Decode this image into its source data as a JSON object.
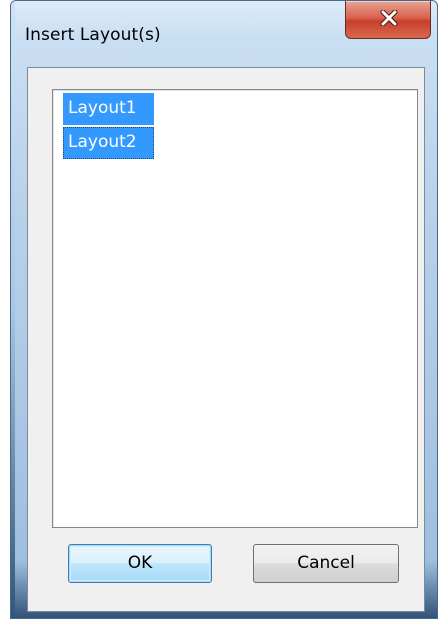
{
  "dialog": {
    "title": "Insert Layout(s)",
    "close_icon": "close-x-icon"
  },
  "layouts": {
    "items": [
      {
        "label": "Layout1",
        "selected": true
      },
      {
        "label": "Layout2",
        "selected": true,
        "focused": true
      }
    ]
  },
  "buttons": {
    "ok_label": "OK",
    "cancel_label": "Cancel"
  },
  "colors": {
    "selection": "#3399ff",
    "close_button": "#c7402a",
    "default_button_border": "#3c7fb1"
  }
}
